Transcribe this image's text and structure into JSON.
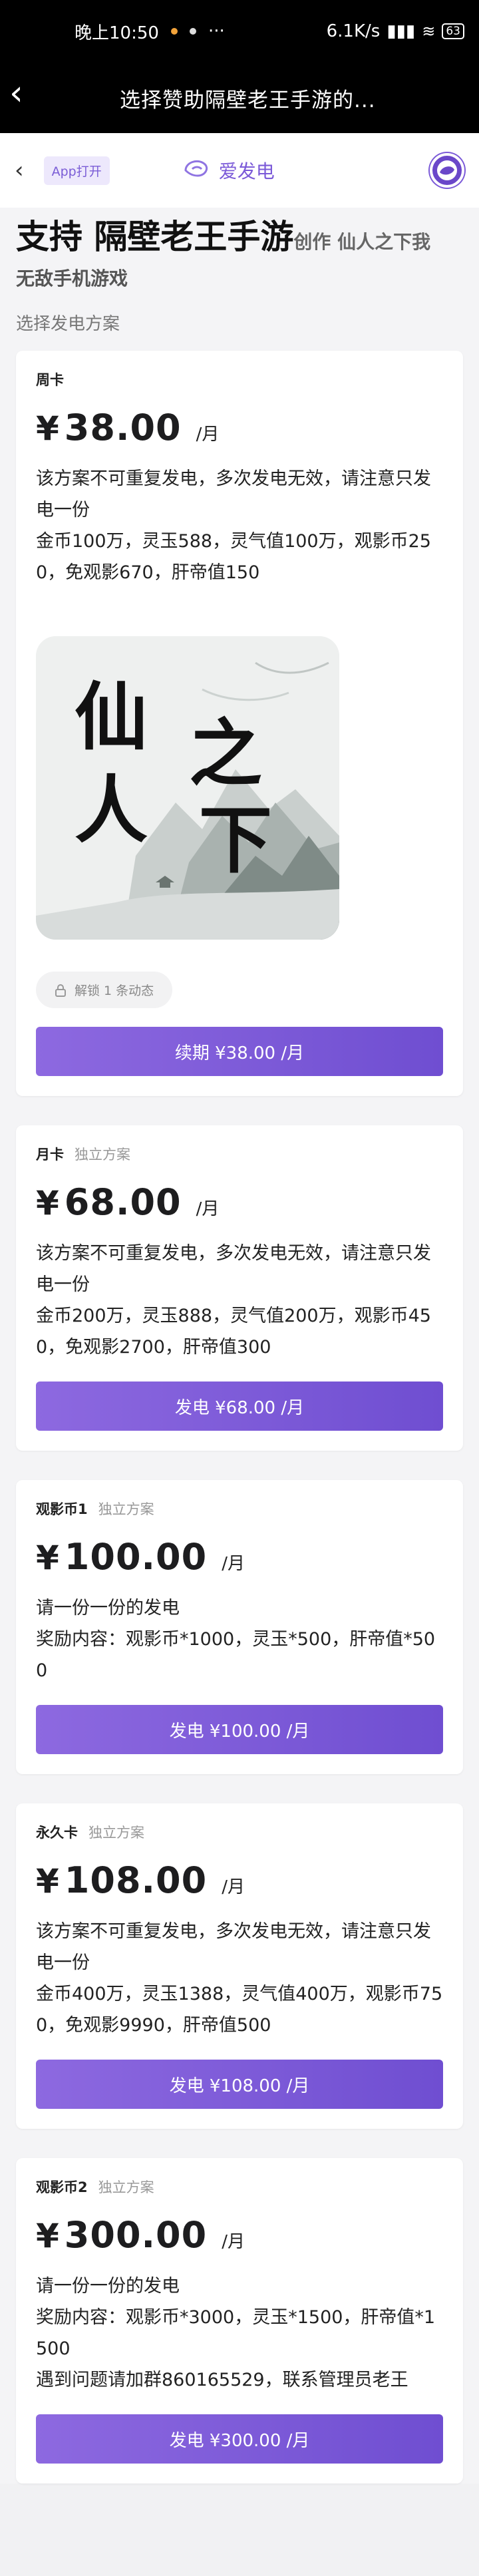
{
  "status": {
    "time": "晚上10:50",
    "network": "6.1K/s",
    "battery": "63"
  },
  "titlebar": {
    "title": "选择赞助隔壁老王手游的..."
  },
  "app_header": {
    "app_open_label": "App打开",
    "brand_name": "爱发电"
  },
  "page": {
    "title_main": "支持 隔壁老王手游",
    "title_suffix": "创作 仙人之下我",
    "subtitle": "无敌手机游戏",
    "section_label": "选择发电方案"
  },
  "plans": [
    {
      "name": "周卡",
      "tag": "",
      "currency": "¥",
      "amount": "38.00",
      "unit": "/月",
      "desc": [
        "该方案不可重复发电，多次发电无效，请注意只发电一份",
        "金币100万，灵玉588，灵气值100万，观影币250，免观影670，肝帝值150"
      ],
      "image_text": [
        "仙",
        "人",
        "之",
        "下"
      ],
      "lock_label": "解锁 1 条动态",
      "button_label": "续期 ¥38.00 /月"
    },
    {
      "name": "月卡",
      "tag": "独立方案",
      "currency": "¥",
      "amount": "68.00",
      "unit": "/月",
      "desc": [
        "该方案不可重复发电，多次发电无效，请注意只发电一份",
        "金币200万，灵玉888，灵气值200万，观影币450，免观影2700，肝帝值300"
      ],
      "button_label": "发电 ¥68.00 /月"
    },
    {
      "name": "观影币1",
      "tag": "独立方案",
      "currency": "¥",
      "amount": "100.00",
      "unit": "/月",
      "desc": [
        "请一份一份的发电",
        "奖励内容：观影币*1000，灵玉*500，肝帝值*500"
      ],
      "button_label": "发电 ¥100.00 /月"
    },
    {
      "name": "永久卡",
      "tag": "独立方案",
      "currency": "¥",
      "amount": "108.00",
      "unit": "/月",
      "desc": [
        "该方案不可重复发电，多次发电无效，请注意只发电一份",
        "金币400万，灵玉1388，灵气值400万，观影币750，免观影9990，肝帝值500"
      ],
      "button_label": "发电 ¥108.00 /月"
    },
    {
      "name": "观影币2",
      "tag": "独立方案",
      "currency": "¥",
      "amount": "300.00",
      "unit": "/月",
      "desc": [
        "请一份一份的发电",
        "奖励内容：观影币*3000，灵玉*1500，肝帝值*1500",
        "遇到问题请加群860165529，联系管理员老王"
      ],
      "button_label": "发电 ¥300.00 /月"
    }
  ]
}
